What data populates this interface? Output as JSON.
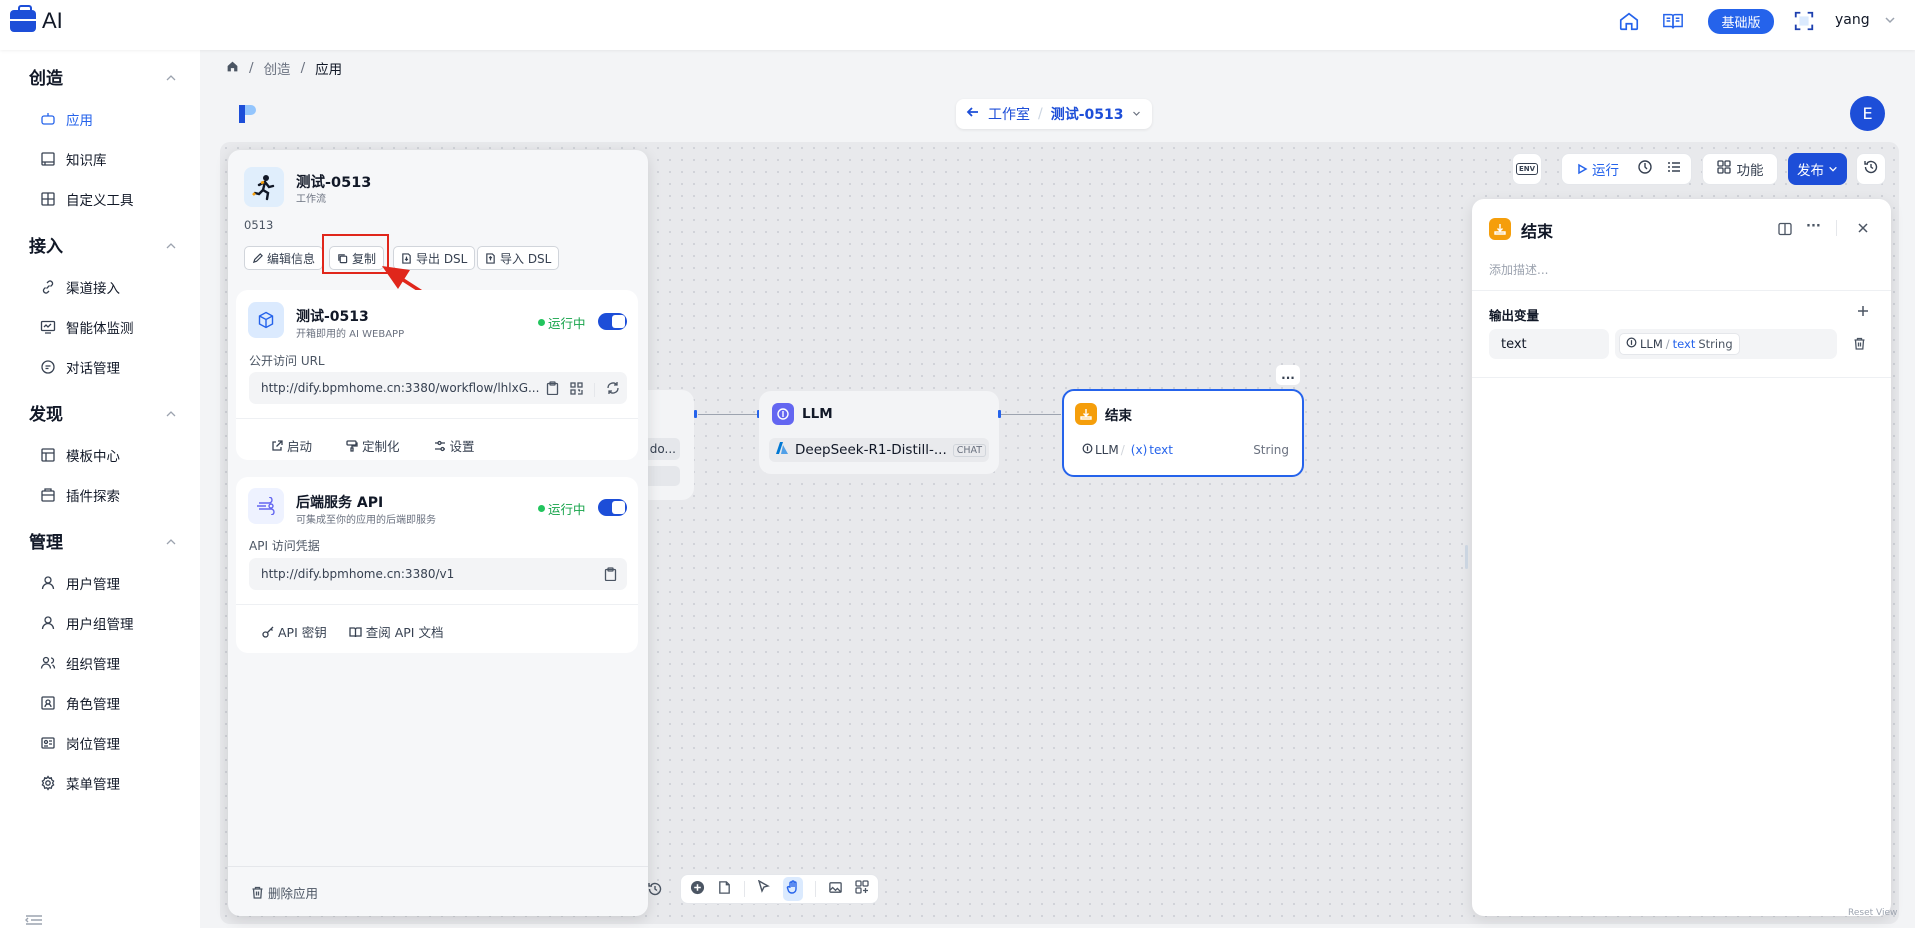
{
  "app": {
    "logo_text": "AI"
  },
  "topbar": {
    "edition_badge": "基础版",
    "user_name": "yang"
  },
  "sidebar": {
    "sections": [
      {
        "title": "创造",
        "items": [
          {
            "label": "应用",
            "active": true
          },
          {
            "label": "知识库"
          },
          {
            "label": "自定义工具"
          }
        ]
      },
      {
        "title": "接入",
        "items": [
          {
            "label": "渠道接入"
          },
          {
            "label": "智能体监测"
          },
          {
            "label": "对话管理"
          }
        ]
      },
      {
        "title": "发现",
        "items": [
          {
            "label": "模板中心"
          },
          {
            "label": "插件探索"
          }
        ]
      },
      {
        "title": "管理",
        "items": [
          {
            "label": "用户管理"
          },
          {
            "label": "用户组管理"
          },
          {
            "label": "组织管理"
          },
          {
            "label": "角色管理"
          },
          {
            "label": "岗位管理"
          },
          {
            "label": "菜单管理"
          }
        ]
      }
    ]
  },
  "breadcrumb": {
    "items": [
      "创造",
      "应用"
    ]
  },
  "workspace": {
    "back_label": "工作室",
    "app_label": "测试-0513"
  },
  "avatar": {
    "letter": "E"
  },
  "toolbar": {
    "env_label": "ENV",
    "run_label": "运行",
    "features_label": "功能",
    "publish_label": "发布"
  },
  "app_panel": {
    "name": "测试-0513",
    "type": "工作流",
    "description": "0513",
    "buttons": {
      "edit_info": "编辑信息",
      "copy": "复制",
      "export_dsl": "导出 DSL",
      "import_dsl": "导入 DSL"
    },
    "webapp_card": {
      "title": "测试-0513",
      "subtitle": "开箱即用的 AI WEBAPP",
      "status": "运行中",
      "url_label": "公开访问 URL",
      "url": "http://dify.bpmhome.cn:3380/workflow/lhlxG...",
      "actions": {
        "launch": "启动",
        "customize": "定制化",
        "settings": "设置"
      }
    },
    "api_card": {
      "title": "后端服务 API",
      "subtitle": "可集成至你的应用的后端即服务",
      "status": "运行中",
      "url_label": "API 访问凭据",
      "url": "http://dify.bpmhome.cn:3380/v1",
      "actions": {
        "api_key": "API 密钥",
        "api_docs": "查阅 API 文档"
      }
    },
    "delete_label": "删除应用"
  },
  "nodes": {
    "start_partial": {
      "text": "do..."
    },
    "llm": {
      "title": "LLM",
      "model": "DeepSeek-R1-Distill-...",
      "mode_tag": "CHAT"
    },
    "end": {
      "title": "结束",
      "var_source": "LLM",
      "var_name": "text",
      "var_type": "String",
      "more": "..."
    }
  },
  "right_panel": {
    "title": "结束",
    "description_placeholder": "添加描述...",
    "section_title": "输出变量",
    "variable": {
      "name": "text",
      "ref_node": "LLM",
      "ref_sep": "/",
      "ref_var": "text",
      "ref_type": "String"
    }
  },
  "footer": {
    "reset_view": "Reset View"
  },
  "colors": {
    "primary": "#1d4ed8",
    "accent": "#2563eb",
    "success": "#22c55e",
    "highlight": "#e0261b",
    "end_node": "#f59e0b",
    "llm_node": "#6366f1"
  }
}
